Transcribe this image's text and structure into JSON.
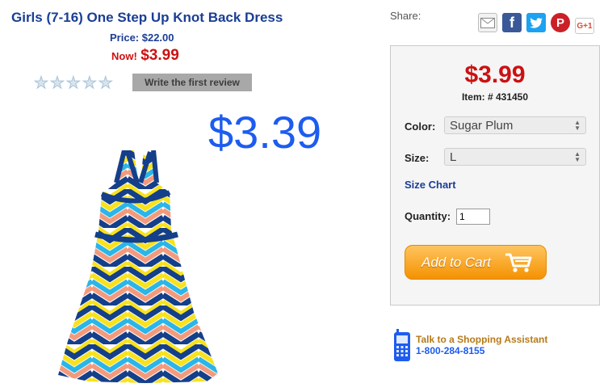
{
  "product": {
    "title": "Girls (7-16) One Step Up Knot Back Dress",
    "price_label": "Price: $22.00",
    "now_label": "Now!",
    "now_price": "$3.99",
    "big_price": "$3.39",
    "rating_stars": 0,
    "review_button": "Write the first review"
  },
  "share": {
    "label": "Share:",
    "icons": [
      "email-icon",
      "facebook-icon",
      "twitter-icon",
      "pinterest-icon",
      "google-plus-icon"
    ],
    "gplus_text": "G+1"
  },
  "cart_box": {
    "price": "$3.99",
    "item_number": "Item: # 431450",
    "color_label": "Color:",
    "color_value": "Sugar Plum",
    "size_label": "Size:",
    "size_value": "L",
    "size_chart": "Size Chart",
    "quantity_label": "Quantity:",
    "quantity_value": "1",
    "add_to_cart": "Add to Cart"
  },
  "assistant": {
    "line1": "Talk to a Shopping Assistant",
    "line2": "1-800-284-8155"
  },
  "colors": {
    "title_blue": "#1a3e95",
    "price_red": "#cc1111",
    "big_price_blue": "#1d5cf0",
    "cart_orange": "#f49200"
  }
}
